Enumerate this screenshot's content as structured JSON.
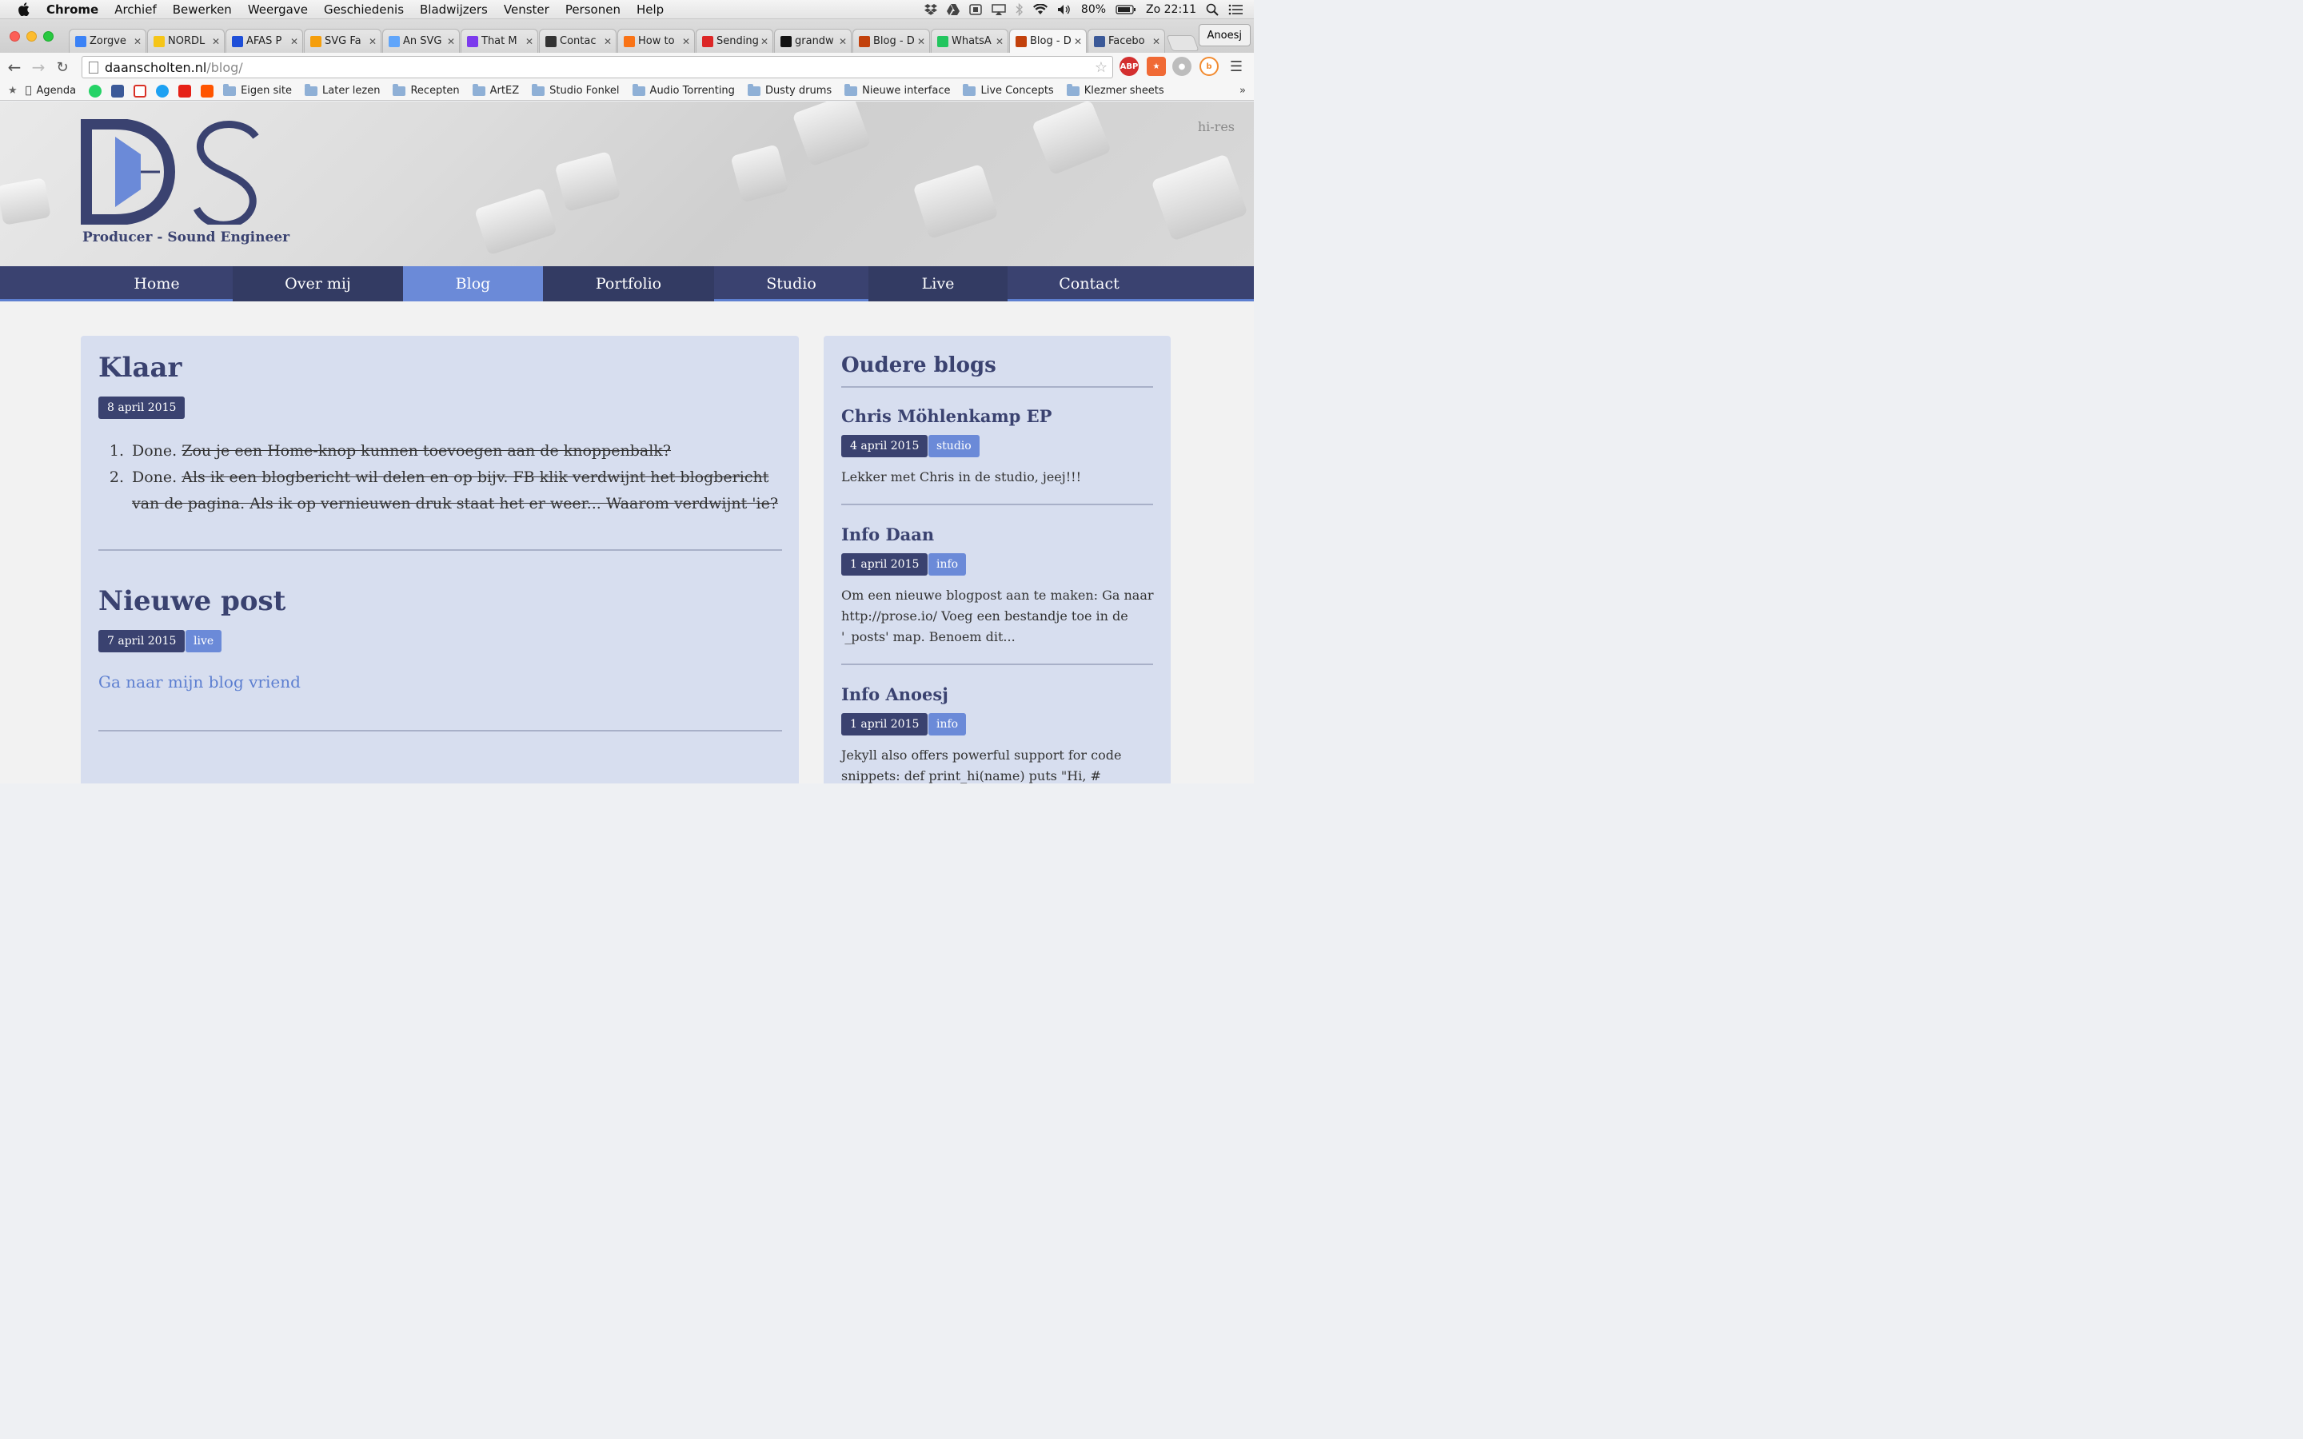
{
  "menubar": {
    "app": "Chrome",
    "items": [
      "Archief",
      "Bewerken",
      "Weergave",
      "Geschiedenis",
      "Bladwijzers",
      "Venster",
      "Personen",
      "Help"
    ],
    "battery": "80%",
    "clock": "Zo 22:11"
  },
  "tabs": [
    {
      "title": "Zorgve",
      "color": "#3b82f6"
    },
    {
      "title": "NORDL",
      "color": "#f5c518"
    },
    {
      "title": "AFAS P",
      "color": "#1d4ed8"
    },
    {
      "title": "SVG Fa",
      "color": "#f59e0b"
    },
    {
      "title": "An SVG",
      "color": "#60a5fa"
    },
    {
      "title": "That M",
      "color": "#7c3aed"
    },
    {
      "title": "Contac",
      "color": "#333333"
    },
    {
      "title": "How to",
      "color": "#f97316"
    },
    {
      "title": "Sending",
      "color": "#dc2626"
    },
    {
      "title": "grandw",
      "color": "#111111"
    },
    {
      "title": "Blog - D",
      "color": "#c2410c"
    },
    {
      "title": "WhatsA",
      "color": "#22c55e"
    },
    {
      "title": "Blog - D",
      "color": "#c2410c"
    },
    {
      "title": "Facebo",
      "color": "#3b5998"
    }
  ],
  "profile": "Anoesj",
  "address": {
    "domain": "daanscholten.nl",
    "path": "/blog/"
  },
  "bookmarks": {
    "apps": [
      "Agenda"
    ],
    "folders": [
      "Eigen site",
      "Later lezen",
      "Recepten",
      "ArtEZ",
      "Studio Fonkel",
      "Audio Torrenting",
      "Dusty drums",
      "Nieuwe interface",
      "Live Concepts",
      "Klezmer sheets"
    ]
  },
  "site": {
    "logo_letters": "DS",
    "tagline": "Producer - Sound Engineer",
    "hires": "hi-res",
    "nav": [
      "Home",
      "Over mij",
      "Blog",
      "Portfolio",
      "Studio",
      "Live",
      "Contact"
    ]
  },
  "posts": [
    {
      "title": "Klaar",
      "date": "8 april 2015",
      "items": [
        {
          "num": "1.",
          "done": "Done.",
          "struck": "Zou je een Home-knop kunnen toevoegen aan de knoppenbalk?"
        },
        {
          "num": "2.",
          "done": "Done.",
          "struck": "Als ik een blogbericht wil delen en op bijv. FB klik verdwijnt het blogbericht van de pagina. Als ik op vernieuwen druk staat het er weer... Waarom verdwijnt 'ie?"
        }
      ]
    },
    {
      "title": "Nieuwe post",
      "date": "7 april 2015",
      "tag": "live",
      "link": "Ga naar mijn blog vriend"
    }
  ],
  "sidebar": {
    "heading": "Oudere blogs",
    "entries": [
      {
        "title": "Chris Möhlenkamp EP",
        "date": "4 april 2015",
        "tag": "studio",
        "text": "Lekker met Chris in de studio, jeej!!!"
      },
      {
        "title": "Info Daan",
        "date": "1 april 2015",
        "tag": "info",
        "text": "Om een nieuwe blogpost aan te maken: Ga naar http://prose.io/ Voeg een bestandje toe in de '_posts' map. Benoem dit..."
      },
      {
        "title": "Info Anoesj",
        "date": "1 april 2015",
        "tag": "info",
        "text": "Jekyll also offers powerful support for code snippets: def print_hi(name) puts \"Hi, #{name}\""
      }
    ]
  },
  "colors": {
    "navy": "#3a4270",
    "accent": "#6b8ad8",
    "panel": "#d7deef"
  }
}
